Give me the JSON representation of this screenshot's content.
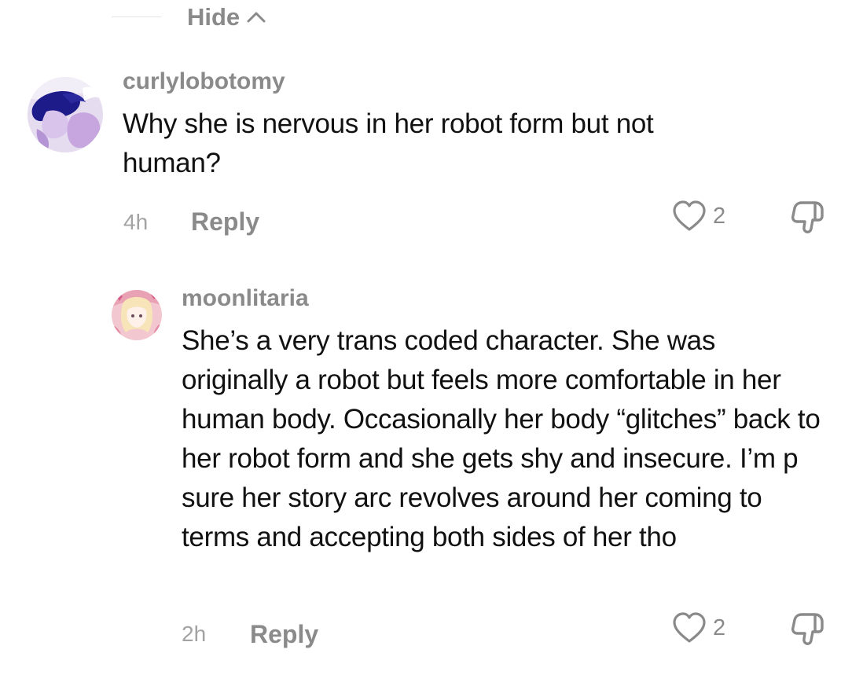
{
  "hide_toggle": {
    "label": "Hide",
    "icon": "chevron-up-icon"
  },
  "comments": [
    {
      "username": "curlylobotomy",
      "text": "Why she is nervous in her robot form but not human?",
      "time": "4h",
      "reply_label": "Reply",
      "likes": "2",
      "like_icon": "heart-icon",
      "dislike_icon": "thumbs-down-icon"
    },
    {
      "username": "moonlitaria",
      "text": "She’s a very trans coded character. She was originally a robot but feels more comfortable in her human body. Occasionally her body “glitches” back to her robot form and she gets shy and insecure. I’m p sure her story arc revolves around her coming to terms and accepting both sides of her tho",
      "time": "2h",
      "reply_label": "Reply",
      "likes": "2",
      "like_icon": "heart-icon",
      "dislike_icon": "thumbs-down-icon"
    }
  ],
  "colors": {
    "secondary_text": "#8a8a8a",
    "timestamp_text": "#a3a3a3",
    "body_text": "#111111"
  }
}
